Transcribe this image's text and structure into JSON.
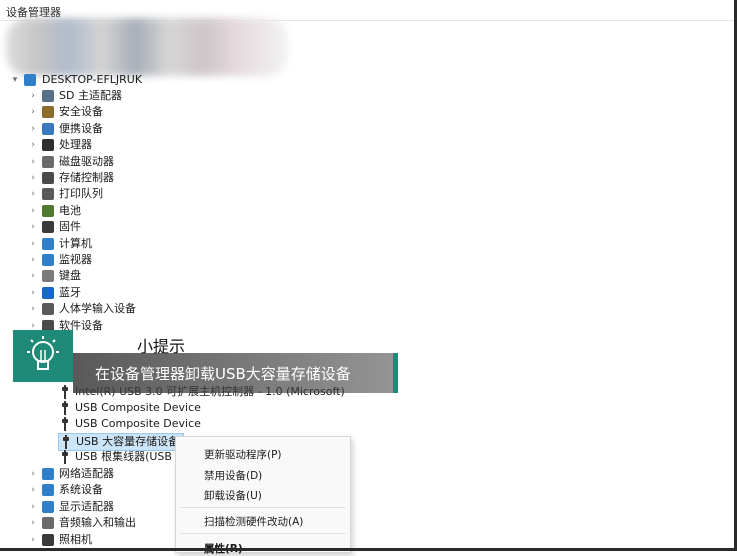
{
  "window": {
    "title": "设备管理器"
  },
  "tree": {
    "root": "DESKTOP-EFLJRUK",
    "categories": [
      {
        "label": "SD 主适配器",
        "icon": "sd-host-adapter-icon",
        "color": "#5a6f8a"
      },
      {
        "label": "安全设备",
        "icon": "security-device-icon",
        "color": "#8a6b2e"
      },
      {
        "label": "便携设备",
        "icon": "portable-device-icon",
        "color": "#3a78c2"
      },
      {
        "label": "处理器",
        "icon": "processor-icon",
        "color": "#2f2f2f"
      },
      {
        "label": "磁盘驱动器",
        "icon": "disk-drive-icon",
        "color": "#6a6a6a"
      },
      {
        "label": "存储控制器",
        "icon": "storage-controller-icon",
        "color": "#4a4a4a"
      },
      {
        "label": "打印队列",
        "icon": "print-queue-icon",
        "color": "#5a5a5a"
      },
      {
        "label": "电池",
        "icon": "battery-icon",
        "color": "#4f7a2f"
      },
      {
        "label": "固件",
        "icon": "firmware-icon",
        "color": "#3a3a3a"
      },
      {
        "label": "计算机",
        "icon": "computer-icon",
        "color": "#2f7fc9"
      },
      {
        "label": "监视器",
        "icon": "monitor-icon",
        "color": "#2f7fc9"
      },
      {
        "label": "键盘",
        "icon": "keyboard-icon",
        "color": "#7a7a7a"
      },
      {
        "label": "蓝牙",
        "icon": "bluetooth-icon",
        "color": "#1769c9"
      },
      {
        "label": "人体学输入设备",
        "icon": "hid-icon",
        "color": "#5a5a5a"
      },
      {
        "label": "软件设备",
        "icon": "software-device-icon",
        "color": "#4a4a4a"
      }
    ],
    "usb_children": [
      {
        "label": "Intel(R) USB 3.0 可扩展主机控制器 - 1.0 (Microsoft)"
      },
      {
        "label": "USB Composite Device"
      },
      {
        "label": "USB Composite Device"
      },
      {
        "label": "USB 大容量存储设备"
      },
      {
        "label": "USB 根集线器(USB 3"
      }
    ],
    "categories_after": [
      {
        "label": "网络适配器",
        "icon": "network-adapter-icon",
        "color": "#2f7fc9"
      },
      {
        "label": "系统设备",
        "icon": "system-device-icon",
        "color": "#2f7fc9"
      },
      {
        "label": "显示适配器",
        "icon": "display-adapter-icon",
        "color": "#2f7fc9"
      },
      {
        "label": "音频输入和输出",
        "icon": "audio-icon",
        "color": "#6a6a6a"
      },
      {
        "label": "照相机",
        "icon": "camera-icon",
        "color": "#3a3a3a"
      }
    ]
  },
  "hint": {
    "title": "小提示",
    "text": "在设备管理器卸载USB大容量存储设备"
  },
  "context_menu": {
    "items": [
      "更新驱动程序(P)",
      "禁用设备(D)",
      "卸载设备(U)",
      "扫描检测硬件改动(A)",
      "属性(R)"
    ]
  }
}
